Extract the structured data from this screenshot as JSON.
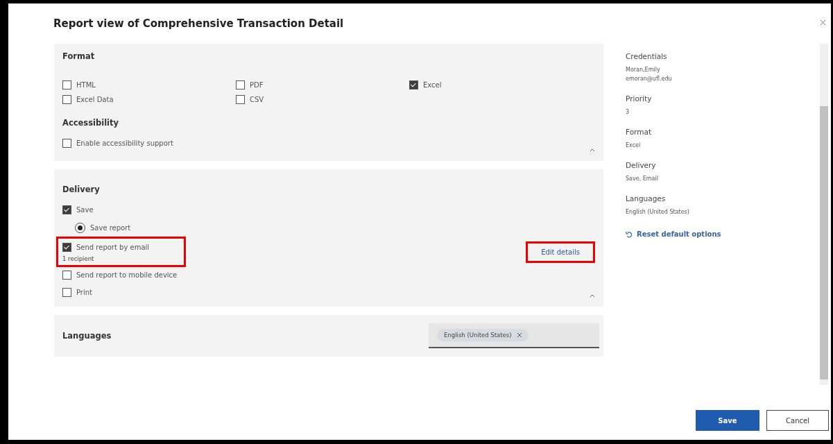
{
  "title": "Report view of Comprehensive Transaction Detail",
  "format": {
    "heading": "Format",
    "options": [
      {
        "label": "HTML",
        "checked": false
      },
      {
        "label": "PDF",
        "checked": false
      },
      {
        "label": "Excel",
        "checked": true
      },
      {
        "label": "Excel Data",
        "checked": false
      },
      {
        "label": "CSV",
        "checked": false
      }
    ],
    "accessibility": {
      "heading": "Accessibility",
      "options": [
        {
          "label": "Enable accessibility support",
          "checked": false
        }
      ]
    }
  },
  "delivery": {
    "heading": "Delivery",
    "items": [
      {
        "kind": "checkbox",
        "label": "Save",
        "checked": true,
        "highlighted": false
      },
      {
        "kind": "radio",
        "label": "Save report",
        "selected": true
      },
      {
        "kind": "checkbox",
        "label": "Send report by email",
        "checked": true,
        "note": "1 recipient",
        "action": "Edit details",
        "highlighted": true
      },
      {
        "kind": "checkbox",
        "label": "Send report to mobile device",
        "checked": false,
        "highlighted": false
      },
      {
        "kind": "checkbox",
        "label": "Print",
        "checked": false,
        "highlighted": false
      }
    ]
  },
  "languages": {
    "heading": "Languages",
    "tags": [
      "English (United States)"
    ]
  },
  "summary": [
    {
      "label": "Credentials",
      "values": [
        "Moran,Emily",
        "emoran@ufl.edu"
      ]
    },
    {
      "label": "Priority",
      "values": [
        "3"
      ]
    },
    {
      "label": "Format",
      "values": [
        "Excel"
      ]
    },
    {
      "label": "Delivery",
      "values": [
        "Save, Email"
      ]
    },
    {
      "label": "Languages",
      "values": [
        "English (United States)"
      ]
    }
  ],
  "reset_link": "Reset default options",
  "buttons": [
    {
      "label": "Save",
      "kind": "primary"
    },
    {
      "label": "Cancel",
      "kind": "secondary"
    }
  ]
}
